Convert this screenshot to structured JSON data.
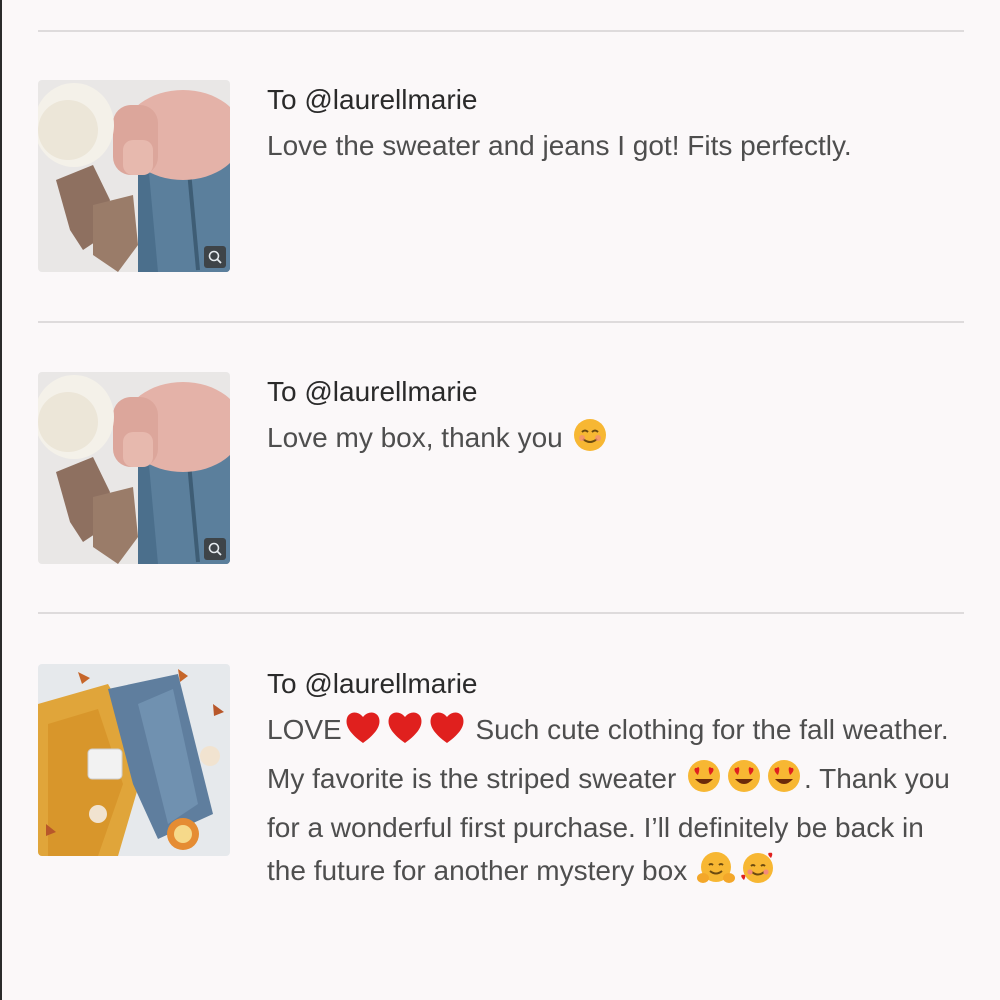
{
  "reviews": [
    {
      "recipient": "To @laurellmarie",
      "message": "Love the sweater and jeans I got! Fits perfectly.",
      "image": "sweater-jeans-boots-flatlay",
      "zoom_icon": "zoom-icon"
    },
    {
      "recipient": "To @laurellmarie",
      "message": "Love my box, thank you",
      "trailing_emoji": "smiling-blush-emoji",
      "image": "sweater-jeans-boots-flatlay",
      "zoom_icon": "zoom-icon"
    },
    {
      "recipient": "To @laurellmarie",
      "message_part1": "LOVE",
      "message_part2": " Such cute clothing for the fall weather. My favorite is the striped sweater ",
      "message_part3": ". Thank you for a wonderful first purchase. I’ll definitely be back in the future for another mystery box ",
      "image": "fall-sweater-jeans-flatlay"
    }
  ],
  "colors": {
    "background": "#fbf8f9",
    "divider": "#dedbdc",
    "heart": "#e0201e",
    "emoji_face": "#f7b733"
  }
}
